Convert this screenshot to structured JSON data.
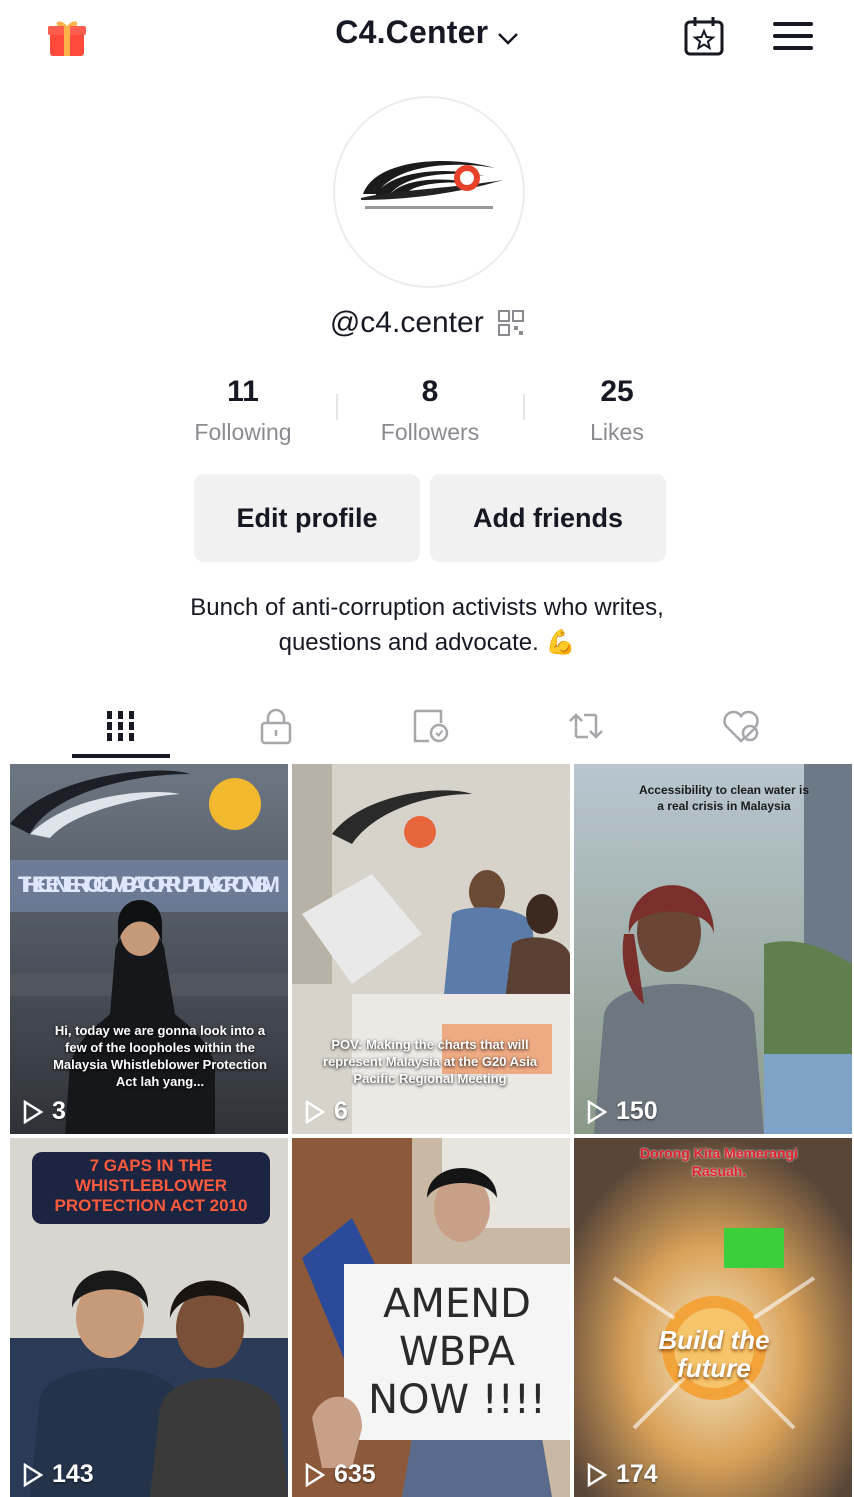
{
  "header": {
    "title": "C4.Center",
    "gift_icon": "gift-icon",
    "calendar_icon": "calendar-star-icon",
    "menu_icon": "hamburger-menu-icon"
  },
  "profile": {
    "handle": "@c4.center",
    "stats": [
      {
        "value": "11",
        "label": "Following"
      },
      {
        "value": "8",
        "label": "Followers"
      },
      {
        "value": "25",
        "label": "Likes"
      }
    ],
    "edit_label": "Edit profile",
    "add_friends_label": "Add friends",
    "bio_line1": "Bunch of anti-corruption activists who writes,",
    "bio_line2": "questions and advocate.",
    "bio_emoji": "💪"
  },
  "tabs": [
    {
      "icon": "grid-videos-icon",
      "active": true
    },
    {
      "icon": "lock-private-icon",
      "active": false
    },
    {
      "icon": "favorites-icon",
      "active": false
    },
    {
      "icon": "repost-icon",
      "active": false
    },
    {
      "icon": "liked-heart-icon",
      "active": false
    }
  ],
  "videos": [
    {
      "views": "3",
      "caption": "Hi, today we are gonna look into a few of the loopholes within the Malaysia Whistleblower Protection Act lah yang...",
      "overlay": "THE CENTER TO COMBAT CORRUPTION & CRONYISM"
    },
    {
      "views": "6",
      "caption": "POV: Making the charts that will represent Malaysia at the G20 Asia Pacific Regional Meeting"
    },
    {
      "views": "150",
      "caption": "Accessibility to clean water is a real crisis in Malaysia"
    },
    {
      "views": "143",
      "caption": "7 GAPS IN THE WHISTLEBLOWER PROTECTION ACT 2010"
    },
    {
      "views": "635",
      "caption": "AMEND WBPA NOW !!!!"
    },
    {
      "views": "174",
      "caption": "Dorong Kita Memerangi Rasuah.",
      "overlay": "Build the future"
    }
  ],
  "colors": {
    "text": "#161823",
    "muted": "#8a8b91",
    "button_bg": "#f1f1f2",
    "brand_orange": "#f2a33a"
  }
}
